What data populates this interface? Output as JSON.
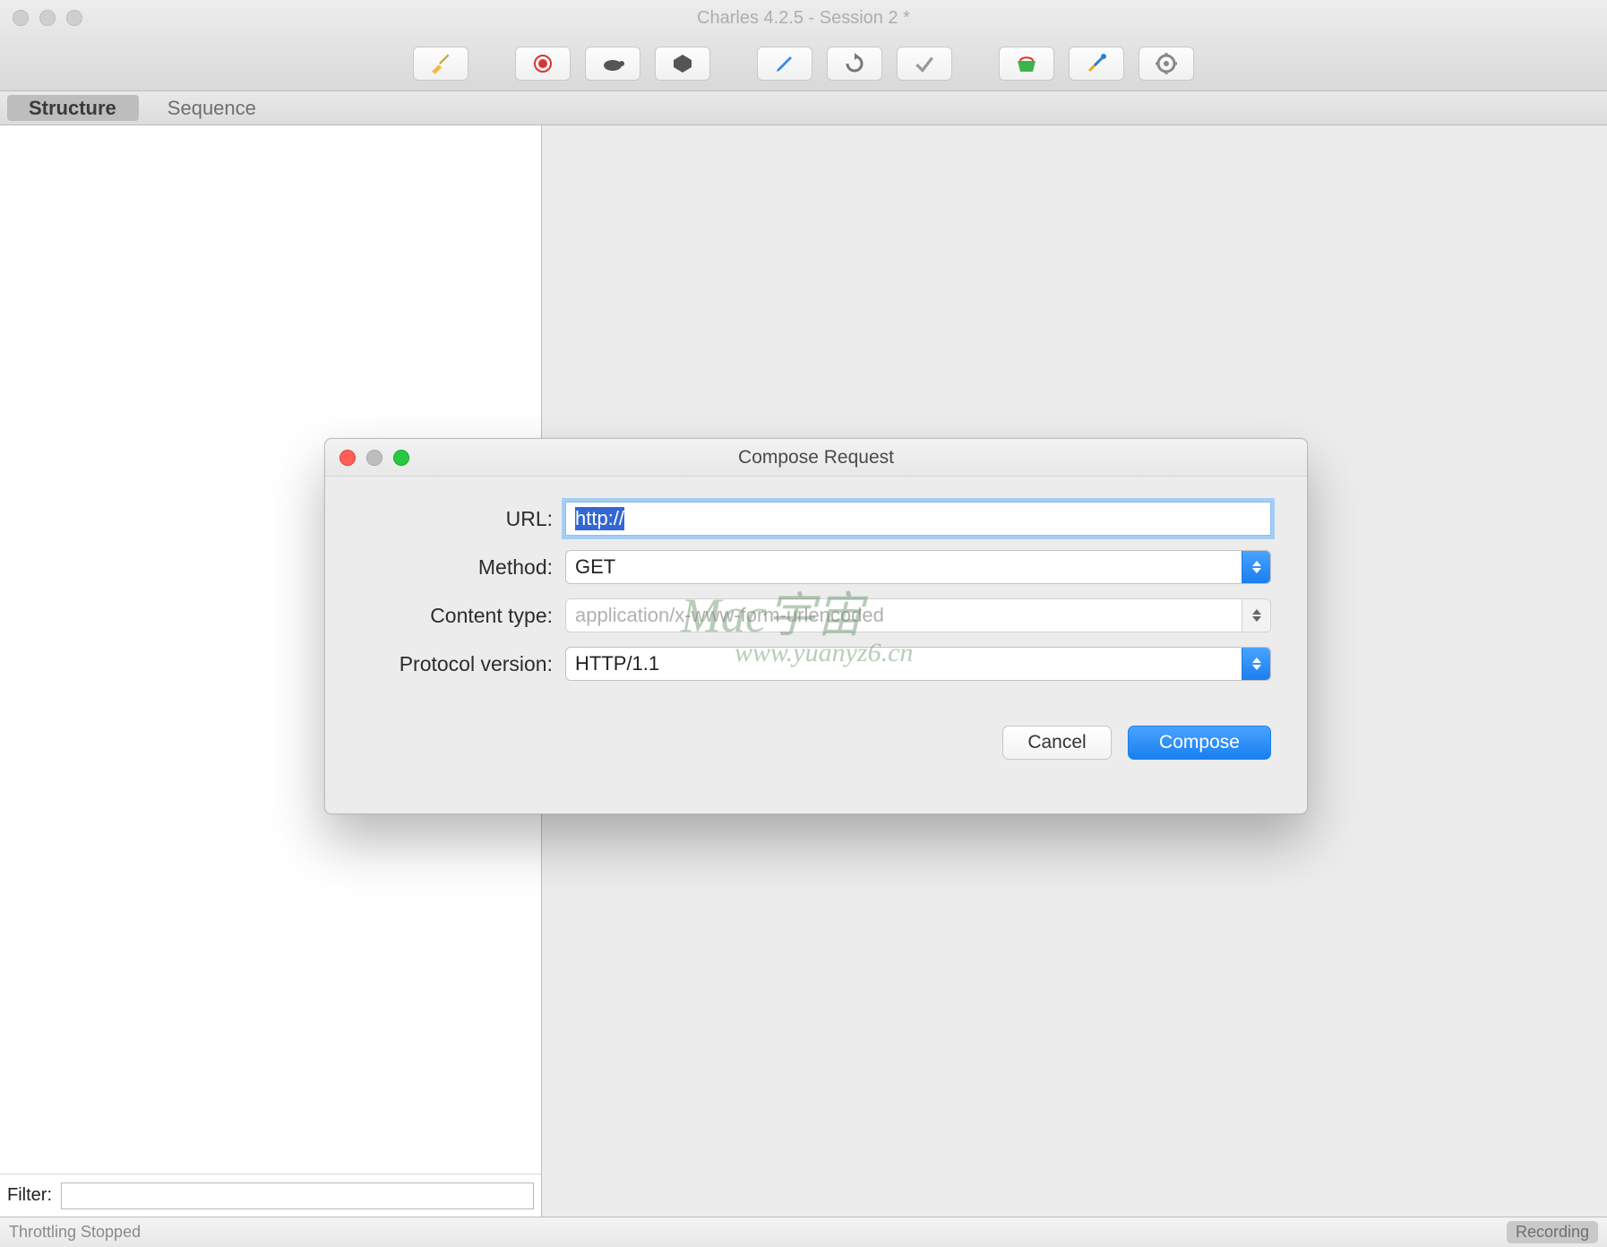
{
  "window": {
    "title": "Charles 4.2.5 - Session 2 *"
  },
  "toolbar": {
    "icons": {
      "broom": "broom-icon",
      "record": "record-icon",
      "turtle": "turtle-icon",
      "breakpoint": "breakpoint-icon",
      "edit": "edit-icon",
      "repeat": "repeat-icon",
      "validate": "validate-icon",
      "basket": "basket-icon",
      "tools": "tools-icon",
      "settings": "settings-icon"
    }
  },
  "tabs": {
    "structure": "Structure",
    "sequence": "Sequence",
    "active": "structure"
  },
  "filter": {
    "label": "Filter:",
    "value": ""
  },
  "statusbar": {
    "throttling": "Throttling Stopped",
    "recording": "Recording"
  },
  "dialog": {
    "title": "Compose Request",
    "fields": {
      "url_label": "URL:",
      "url_value": "http://",
      "method_label": "Method:",
      "method_value": "GET",
      "content_type_label": "Content type:",
      "content_type_placeholder": "application/x-www-form-urlencoded",
      "protocol_label": "Protocol version:",
      "protocol_value": "HTTP/1.1"
    },
    "buttons": {
      "cancel": "Cancel",
      "compose": "Compose"
    }
  },
  "watermark": {
    "line1": "Mac宇宙",
    "line2": "www.yuanyz6.cn"
  }
}
